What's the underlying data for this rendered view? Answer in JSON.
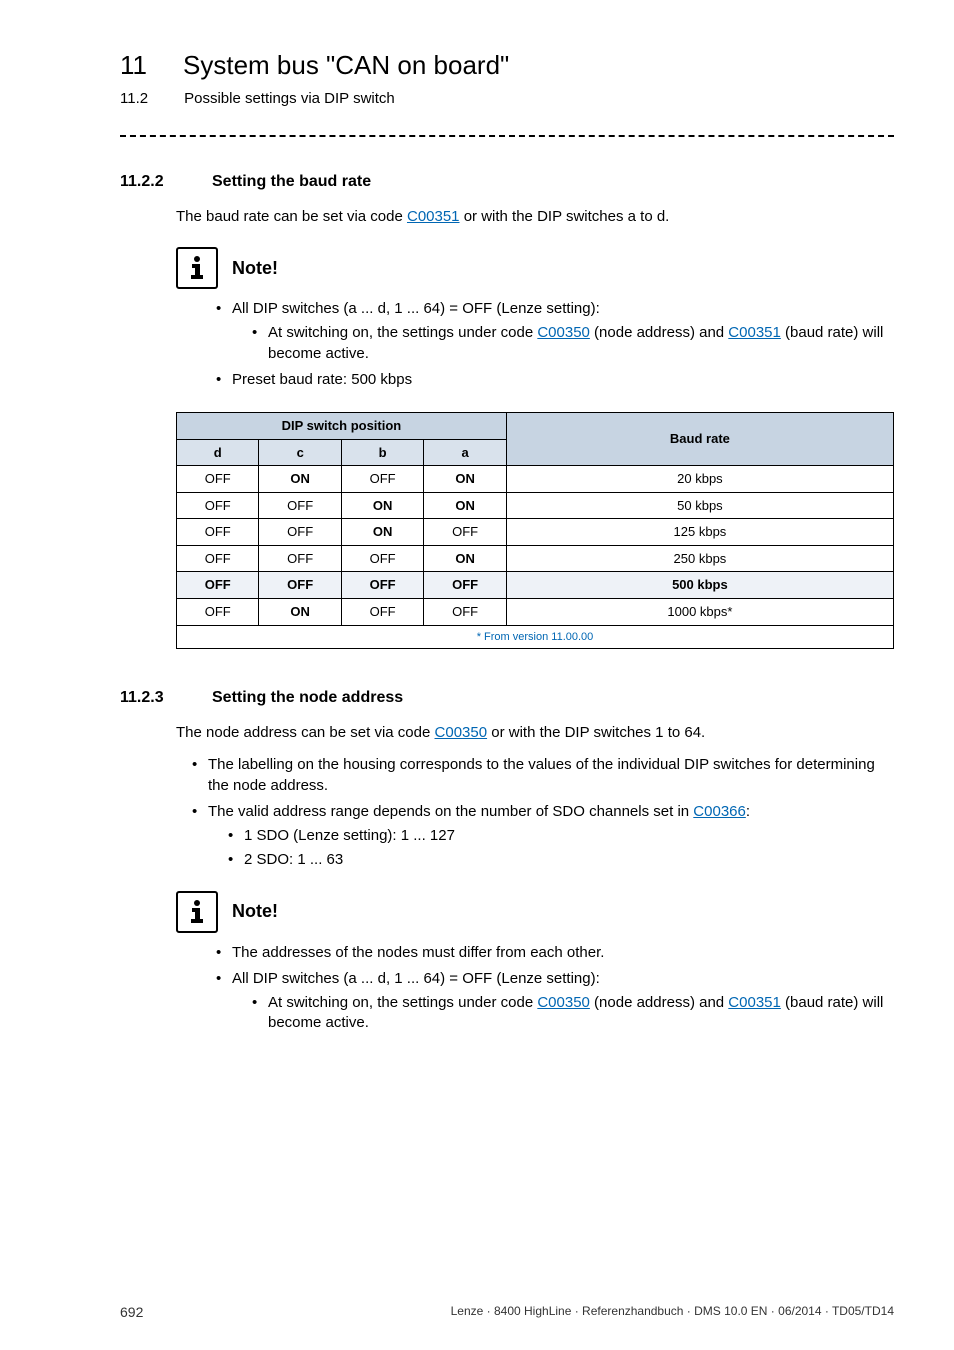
{
  "chapter": {
    "num": "11",
    "title": "System bus \"CAN on board\""
  },
  "subchapter": {
    "num": "11.2",
    "title": "Possible settings via DIP switch"
  },
  "sec1": {
    "num": "11.2.2",
    "title": "Setting the baud rate",
    "intro_pre": "The baud rate can be set via code ",
    "intro_link": "C00351",
    "intro_post": " or with the DIP switches a to d."
  },
  "note_label": "Note!",
  "note1": {
    "b1a": "All DIP switches (a ... d, 1 ... 64) = OFF (Lenze setting):",
    "b2a_pre": "At switching on, the settings under code ",
    "b2a_link1": "C00350",
    "b2a_mid": " (node address) and ",
    "b2a_link2": "C00351",
    "b2a_post": " (baud rate) will become active.",
    "b1b": "Preset baud rate: 500 kbps"
  },
  "table": {
    "head_group": "DIP switch position",
    "head_baud": "Baud rate",
    "cols": {
      "d": "d",
      "c": "c",
      "b": "b",
      "a": "a"
    },
    "rows": [
      {
        "d": "OFF",
        "c": "ON",
        "b": "OFF",
        "a": "ON",
        "rate": "20 kbps",
        "bold": [
          "c",
          "a"
        ]
      },
      {
        "d": "OFF",
        "c": "OFF",
        "b": "ON",
        "a": "ON",
        "rate": "50 kbps",
        "bold": [
          "b",
          "a"
        ]
      },
      {
        "d": "OFF",
        "c": "OFF",
        "b": "ON",
        "a": "OFF",
        "rate": "125 kbps",
        "bold": [
          "b"
        ]
      },
      {
        "d": "OFF",
        "c": "OFF",
        "b": "OFF",
        "a": "ON",
        "rate": "250 kbps",
        "bold": [
          "a"
        ]
      },
      {
        "d": "OFF",
        "c": "OFF",
        "b": "OFF",
        "a": "OFF",
        "rate": "500 kbps",
        "hl": true
      },
      {
        "d": "OFF",
        "c": "ON",
        "b": "OFF",
        "a": "OFF",
        "rate": "1000 kbps*",
        "bold": [
          "c"
        ]
      }
    ],
    "footnote": "* From version 11.00.00"
  },
  "sec2": {
    "num": "11.2.3",
    "title": "Setting the node address",
    "intro_pre": "The node address can be set via code ",
    "intro_link": "C00350",
    "intro_post": " or with the DIP switches 1 to 64.",
    "b1a": "The labelling on the housing corresponds to the values of the individual DIP switches for determining the node address.",
    "b1b_pre": "The valid address range depends on the number of SDO channels set in ",
    "b1b_link": "C00366",
    "b1b_post": ":",
    "b2a": "1 SDO (Lenze setting): 1 ... 127",
    "b2b": "2 SDO: 1 ... 63"
  },
  "note2": {
    "b1a": "The addresses of the nodes must differ from each other.",
    "b1b": "All DIP switches (a ... d, 1 ... 64) = OFF (Lenze setting):",
    "b2a_pre": "At switching on, the settings under code ",
    "b2a_link1": "C00350",
    "b2a_mid": " (node address) and ",
    "b2a_link2": "C00351",
    "b2a_post": " (baud rate) will become active."
  },
  "footer": {
    "page": "692",
    "doc": "Lenze · 8400 HighLine · Referenzhandbuch · DMS 10.0 EN · 06/2014 · TD05/TD14"
  }
}
